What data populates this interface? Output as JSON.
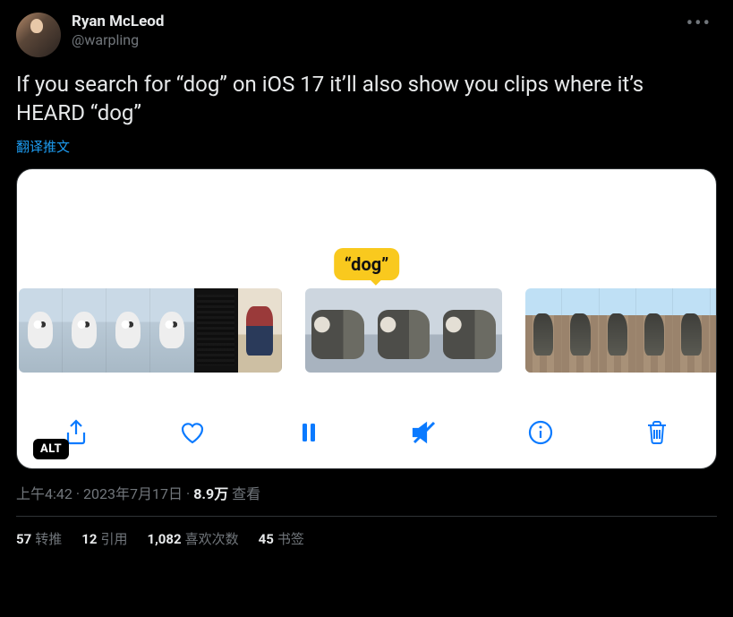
{
  "author": {
    "display_name": "Ryan McLeod",
    "handle": "@warpling"
  },
  "tweet_text": "If you search for “dog” on iOS 17 it’ll also show you clips where it’s HEARD “dog”",
  "translate_label": "翻译推文",
  "media": {
    "search_bubble": "“dog”",
    "alt_badge": "ALT"
  },
  "meta": {
    "time": "上午4:42",
    "date": "2023年7月17日",
    "views_count": "8.9万",
    "views_label": "查看"
  },
  "stats": {
    "retweets": {
      "count": "57",
      "label": "转推"
    },
    "quotes": {
      "count": "12",
      "label": "引用"
    },
    "likes": {
      "count": "1,082",
      "label": "喜欢次数"
    },
    "bookmarks": {
      "count": "45",
      "label": "书签"
    }
  }
}
